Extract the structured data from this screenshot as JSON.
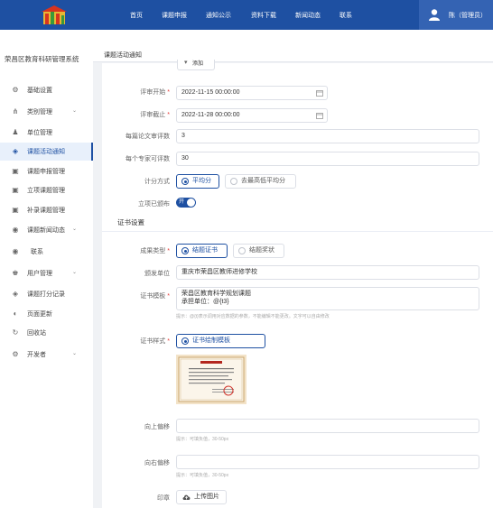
{
  "nav": {
    "items": [
      "首页",
      "课题申报",
      "通知公示",
      "资料下载",
      "新闻动态",
      "联系"
    ]
  },
  "user": {
    "name": "陈（管理员）"
  },
  "sidebar": {
    "system_title": "荣昌区教育科研管理系统",
    "items": [
      {
        "label": "基础设置",
        "icon": "gear-icon",
        "chevron": false,
        "active": false
      },
      {
        "label": "类别管理",
        "icon": "tree-icon",
        "chevron": true,
        "active": false
      },
      {
        "label": "单位管理",
        "icon": "user-icon",
        "chevron": false,
        "active": false
      },
      {
        "label": "课题活动通知",
        "icon": "layers-icon",
        "chevron": false,
        "active": true
      },
      {
        "label": "课题申报管理",
        "icon": "doc-icon",
        "chevron": false,
        "active": false
      },
      {
        "label": "立项课题管理",
        "icon": "doc-icon",
        "chevron": false,
        "active": false
      },
      {
        "label": "补录课题管理",
        "icon": "doc-icon",
        "chevron": false,
        "active": false
      },
      {
        "label": "课题新闻动态",
        "icon": "broadcast-icon",
        "chevron": true,
        "active": false
      },
      {
        "label": "联系",
        "icon": "broadcast-icon",
        "chevron": false,
        "active": false
      },
      {
        "label": "用户管理",
        "icon": "user-group-icon",
        "chevron": true,
        "active": false
      },
      {
        "label": "课题打分记录",
        "icon": "layers-icon",
        "chevron": false,
        "active": false
      },
      {
        "label": "页面更新",
        "icon": "palette-icon",
        "chevron": false,
        "active": false
      },
      {
        "label": "回收站",
        "icon": "recycle-icon",
        "chevron": false,
        "active": false
      },
      {
        "label": "开发者",
        "icon": "gear-icon",
        "chevron": true,
        "active": false
      }
    ]
  },
  "main": {
    "title": "课题活动通知"
  },
  "form": {
    "review_start": {
      "label": "评审开始",
      "value": "2022-11-15 00:00:00"
    },
    "review_end": {
      "label": "评审截止",
      "value": "2022-11-28 00:00:00"
    },
    "papers_per_expert": {
      "label": "每篇论文审评数",
      "value": "3"
    },
    "reviews_per_expert": {
      "label": "每个专家可评数",
      "value": "30"
    },
    "scoring": {
      "label": "计分方式",
      "options": [
        "平均分",
        "去最高低平均分"
      ],
      "selected": 0
    },
    "published": {
      "label": "立项已颁布",
      "toggle_text": "开"
    },
    "cert_section": "证书设置",
    "result_type": {
      "label": "成果类型",
      "options": [
        "结题证书",
        "结题奖状"
      ],
      "selected": 0
    },
    "issuer": {
      "label": "颁发单位",
      "value": "重庆市荣昌区教师进修学校"
    },
    "cert_template": {
      "label": "证书模板",
      "lines": [
        "荣昌区教育科学规划课题",
        "承担单位：@{t3}"
      ],
      "hint": "提示：@{t}表示调用对应数据的参数，不能编辑不能更改。文字可以自由修改"
    },
    "cert_style": {
      "label": "证书样式",
      "option": "证书绘制模板"
    },
    "offset_up": {
      "label": "向上偏移",
      "value": "",
      "hint": "提示：可填负值，30-50px"
    },
    "offset_right": {
      "label": "向右偏移",
      "value": "",
      "hint": "提示：可填负值，30-50px"
    },
    "seal": {
      "label": "印章",
      "button": "上传图片"
    },
    "top_cut_button": "添加"
  },
  "colors": {
    "primary": "#1e50a2",
    "required": "#e53935"
  }
}
